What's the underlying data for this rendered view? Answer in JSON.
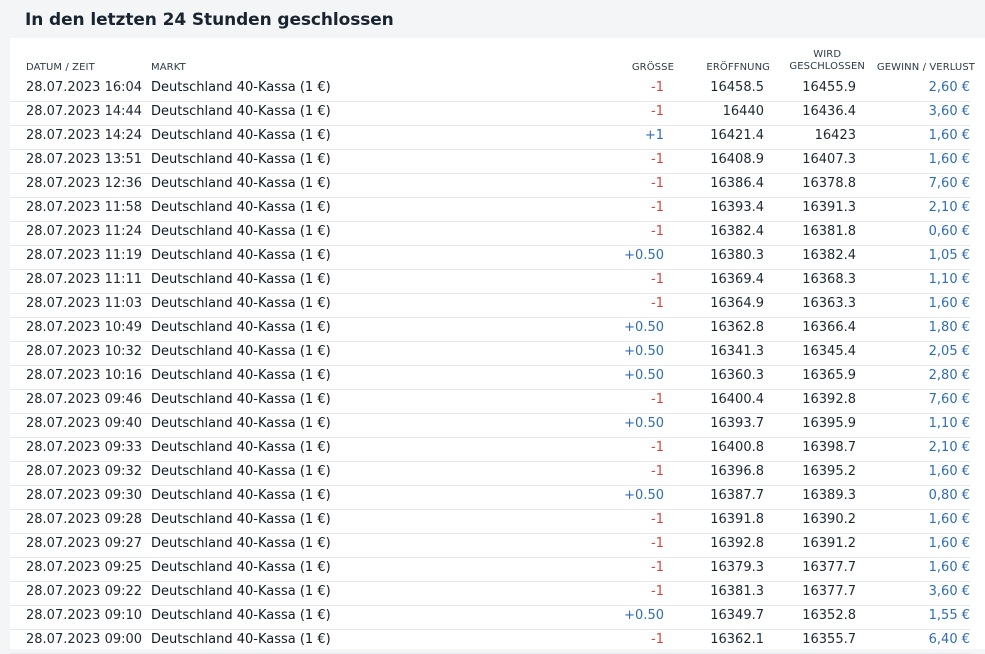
{
  "title": "In den letzten 24 Stunden geschlossen",
  "columns": {
    "date": "DATUM / ZEIT",
    "market": "MARKT",
    "size": "GRÖSSE",
    "open": "ERÖFFNUNG",
    "close_line1": "WIRD",
    "close_line2": "GESCHLOSSEN",
    "pl": "GEWINN / VERLUST"
  },
  "colors": {
    "negative": "#d0453a",
    "positive": "#2f6db5",
    "profit": "#2f6db5"
  },
  "rows": [
    {
      "date": "28.07.2023 16:04",
      "market": "Deutschland 40-Kassa (1 €)",
      "size": "-1",
      "open": "16458.5",
      "close": "16455.9",
      "pl": "2,60 €"
    },
    {
      "date": "28.07.2023 14:44",
      "market": "Deutschland 40-Kassa (1 €)",
      "size": "-1",
      "open": "16440",
      "close": "16436.4",
      "pl": "3,60 €"
    },
    {
      "date": "28.07.2023 14:24",
      "market": "Deutschland 40-Kassa (1 €)",
      "size": "+1",
      "open": "16421.4",
      "close": "16423",
      "pl": "1,60 €"
    },
    {
      "date": "28.07.2023 13:51",
      "market": "Deutschland 40-Kassa (1 €)",
      "size": "-1",
      "open": "16408.9",
      "close": "16407.3",
      "pl": "1,60 €"
    },
    {
      "date": "28.07.2023 12:36",
      "market": "Deutschland 40-Kassa (1 €)",
      "size": "-1",
      "open": "16386.4",
      "close": "16378.8",
      "pl": "7,60 €"
    },
    {
      "date": "28.07.2023 11:58",
      "market": "Deutschland 40-Kassa (1 €)",
      "size": "-1",
      "open": "16393.4",
      "close": "16391.3",
      "pl": "2,10 €"
    },
    {
      "date": "28.07.2023 11:24",
      "market": "Deutschland 40-Kassa (1 €)",
      "size": "-1",
      "open": "16382.4",
      "close": "16381.8",
      "pl": "0,60 €"
    },
    {
      "date": "28.07.2023 11:19",
      "market": "Deutschland 40-Kassa (1 €)",
      "size": "+0.50",
      "open": "16380.3",
      "close": "16382.4",
      "pl": "1,05 €"
    },
    {
      "date": "28.07.2023 11:11",
      "market": "Deutschland 40-Kassa (1 €)",
      "size": "-1",
      "open": "16369.4",
      "close": "16368.3",
      "pl": "1,10 €"
    },
    {
      "date": "28.07.2023 11:03",
      "market": "Deutschland 40-Kassa (1 €)",
      "size": "-1",
      "open": "16364.9",
      "close": "16363.3",
      "pl": "1,60 €"
    },
    {
      "date": "28.07.2023 10:49",
      "market": "Deutschland 40-Kassa (1 €)",
      "size": "+0.50",
      "open": "16362.8",
      "close": "16366.4",
      "pl": "1,80 €"
    },
    {
      "date": "28.07.2023 10:32",
      "market": "Deutschland 40-Kassa (1 €)",
      "size": "+0.50",
      "open": "16341.3",
      "close": "16345.4",
      "pl": "2,05 €"
    },
    {
      "date": "28.07.2023 10:16",
      "market": "Deutschland 40-Kassa (1 €)",
      "size": "+0.50",
      "open": "16360.3",
      "close": "16365.9",
      "pl": "2,80 €"
    },
    {
      "date": "28.07.2023 09:46",
      "market": "Deutschland 40-Kassa (1 €)",
      "size": "-1",
      "open": "16400.4",
      "close": "16392.8",
      "pl": "7,60 €"
    },
    {
      "date": "28.07.2023 09:40",
      "market": "Deutschland 40-Kassa (1 €)",
      "size": "+0.50",
      "open": "16393.7",
      "close": "16395.9",
      "pl": "1,10 €"
    },
    {
      "date": "28.07.2023 09:33",
      "market": "Deutschland 40-Kassa (1 €)",
      "size": "-1",
      "open": "16400.8",
      "close": "16398.7",
      "pl": "2,10 €"
    },
    {
      "date": "28.07.2023 09:32",
      "market": "Deutschland 40-Kassa (1 €)",
      "size": "-1",
      "open": "16396.8",
      "close": "16395.2",
      "pl": "1,60 €"
    },
    {
      "date": "28.07.2023 09:30",
      "market": "Deutschland 40-Kassa (1 €)",
      "size": "+0.50",
      "open": "16387.7",
      "close": "16389.3",
      "pl": "0,80 €"
    },
    {
      "date": "28.07.2023 09:28",
      "market": "Deutschland 40-Kassa (1 €)",
      "size": "-1",
      "open": "16391.8",
      "close": "16390.2",
      "pl": "1,60 €"
    },
    {
      "date": "28.07.2023 09:27",
      "market": "Deutschland 40-Kassa (1 €)",
      "size": "-1",
      "open": "16392.8",
      "close": "16391.2",
      "pl": "1,60 €"
    },
    {
      "date": "28.07.2023 09:25",
      "market": "Deutschland 40-Kassa (1 €)",
      "size": "-1",
      "open": "16379.3",
      "close": "16377.7",
      "pl": "1,60 €"
    },
    {
      "date": "28.07.2023 09:22",
      "market": "Deutschland 40-Kassa (1 €)",
      "size": "-1",
      "open": "16381.3",
      "close": "16377.7",
      "pl": "3,60 €"
    },
    {
      "date": "28.07.2023 09:10",
      "market": "Deutschland 40-Kassa (1 €)",
      "size": "+0.50",
      "open": "16349.7",
      "close": "16352.8",
      "pl": "1,55 €"
    },
    {
      "date": "28.07.2023 09:00",
      "market": "Deutschland 40-Kassa (1 €)",
      "size": "-1",
      "open": "16362.1",
      "close": "16355.7",
      "pl": "6,40 €"
    }
  ]
}
